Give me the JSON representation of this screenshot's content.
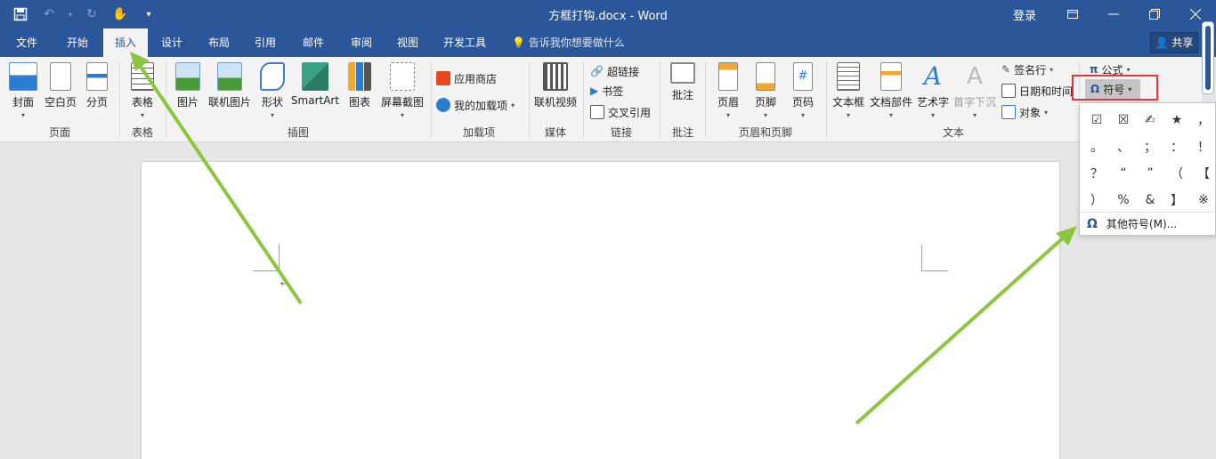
{
  "window": {
    "title": "方框打钩.docx - Word",
    "login": "登录",
    "ribbon_display_icon": "ribbon-display-icon",
    "minimize_icon": "minimize-icon",
    "restore_icon": "restore-icon",
    "close_icon": "close-icon"
  },
  "qat": {
    "save_icon": "save-icon",
    "undo_icon": "undo-icon",
    "redo_icon": "redo-icon",
    "touch_icon": "touch-mode-icon",
    "customize_icon": "customize-qat-icon"
  },
  "tabs": {
    "file": "文件",
    "home": "开始",
    "insert": "插入",
    "design": "设计",
    "layout": "布局",
    "references": "引用",
    "mailings": "邮件",
    "review": "审阅",
    "view": "视图",
    "developer": "开发工具",
    "tellme": "告诉我你想要做什么",
    "share": "共享",
    "active": "插入"
  },
  "ribbon": {
    "pages": {
      "cover": "封面",
      "blank": "空白页",
      "break": "分页",
      "label": "页面"
    },
    "tables": {
      "table": "表格",
      "label": "表格"
    },
    "illustrations": {
      "picture": "图片",
      "online_picture": "联机图片",
      "shapes": "形状",
      "smartart": "SmartArt",
      "chart": "图表",
      "screenshot": "屏幕截图",
      "label": "插图"
    },
    "addins": {
      "store": "应用商店",
      "my_addins": "我的加载项",
      "label": "加载项"
    },
    "media": {
      "online_video": "联机视频",
      "label": "媒体"
    },
    "links": {
      "hyperlink": "超链接",
      "bookmark": "书签",
      "crossref": "交叉引用",
      "label": "链接"
    },
    "comments": {
      "comment": "批注",
      "label": "批注"
    },
    "header_footer": {
      "header": "页眉",
      "footer": "页脚",
      "page_number": "页码",
      "label": "页眉和页脚"
    },
    "text": {
      "textbox": "文本框",
      "quickparts": "文档部件",
      "wordart": "艺术字",
      "dropcap": "首字下沉",
      "signature": "签名行",
      "datetime": "日期和时间",
      "object": "对象",
      "label": "文本"
    },
    "symbols": {
      "equation": "公式",
      "symbol": "符号"
    }
  },
  "symbol_menu": {
    "symbols": [
      "☑",
      "☒",
      "✍",
      "★",
      "，",
      "。",
      "、",
      "；",
      "：",
      "！",
      "？",
      "“",
      "”",
      "（",
      "【",
      "）",
      "%",
      "&",
      "】",
      "※"
    ],
    "more_label": "其他符号(M)..."
  },
  "colors": {
    "brand": "#2b579a",
    "highlight_box": "#e53935",
    "arrow": "#8cc63f"
  }
}
